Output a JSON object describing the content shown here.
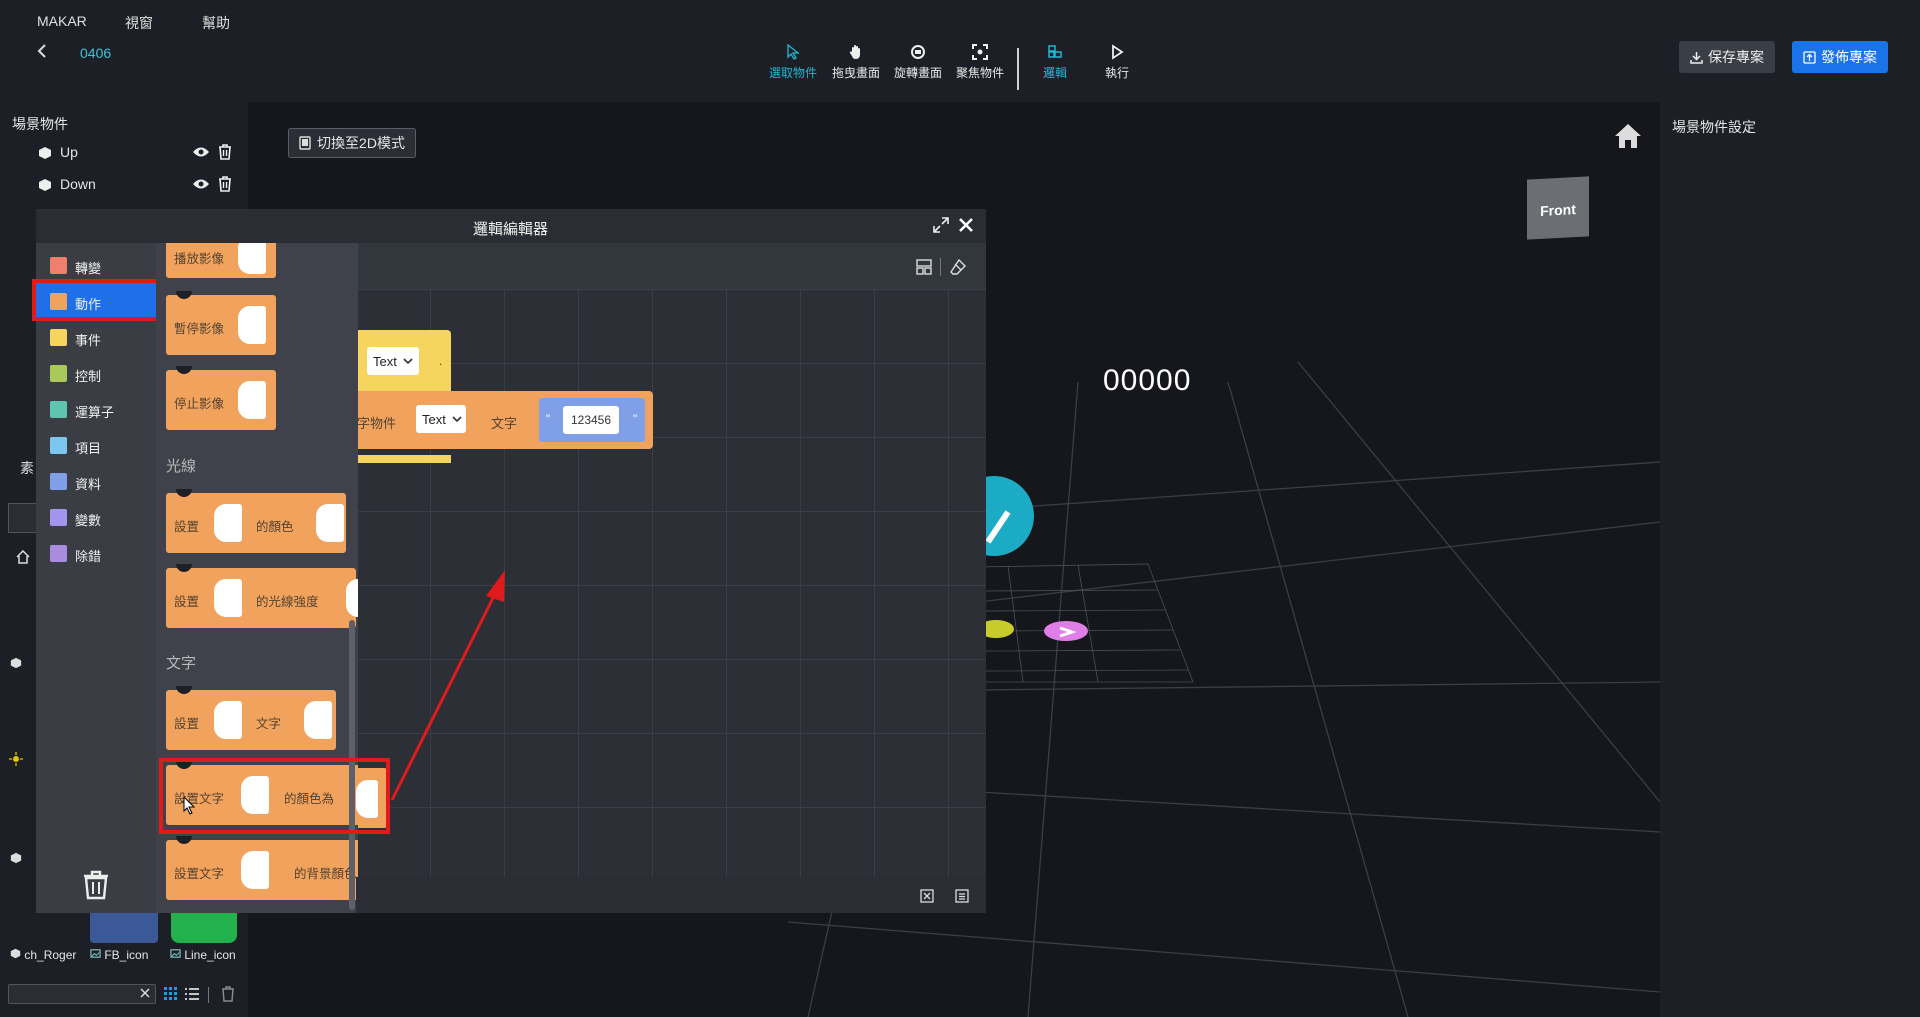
{
  "menu": [
    "MAKAR",
    "視窗",
    "幫助"
  ],
  "project_name": "0406",
  "tools": [
    {
      "label": "選取物件",
      "active": true
    },
    {
      "label": "拖曳畫面",
      "active": false
    },
    {
      "label": "旋轉畫面",
      "active": false
    },
    {
      "label": "聚焦物件",
      "active": false
    },
    {
      "label": "邏輯",
      "active": true
    },
    {
      "label": "執行",
      "active": false
    }
  ],
  "buttons": {
    "save": "保存專案",
    "publish": "發佈專案",
    "mode2d": "切換至2D模式"
  },
  "scene": {
    "title": "場景物件",
    "items": [
      {
        "name": "Up"
      },
      {
        "name": "Down"
      }
    ]
  },
  "right_panel": {
    "title": "場景物件設定"
  },
  "viewport": {
    "score": "00000",
    "cube_label": "Front"
  },
  "editor": {
    "title": "邏輯編輯器",
    "categories": [
      {
        "label": "轉變",
        "color": "#f07f6c"
      },
      {
        "label": "動作",
        "color": "#f1a35e",
        "selected": true
      },
      {
        "label": "事件",
        "color": "#f6d55f"
      },
      {
        "label": "控制",
        "color": "#a9c95b"
      },
      {
        "label": "運算子",
        "color": "#5fc5b0"
      },
      {
        "label": "項目",
        "color": "#7cc7ee"
      },
      {
        "label": "資料",
        "color": "#7fa0e8"
      },
      {
        "label": "變數",
        "color": "#a394f0"
      },
      {
        "label": "除錯",
        "color": "#a98be0"
      }
    ],
    "flyout": {
      "blocks_top": [
        {
          "label": "播放影像"
        },
        {
          "label": "暫停影像"
        },
        {
          "label": "停止影像"
        }
      ],
      "section_light": "光線",
      "light_blocks": [
        {
          "prefix": "設置",
          "suffix": "的顏色"
        },
        {
          "prefix": "設置",
          "suffix": "的光線強度"
        }
      ],
      "section_text": "文字",
      "text_blocks": [
        {
          "prefix": "設置",
          "suffix": "文字"
        },
        {
          "prefix": "設置文字",
          "suffix": "的顏色為"
        },
        {
          "prefix": "設置文字",
          "suffix": "的背景顏色"
        }
      ]
    },
    "workspace": {
      "select_top": "Text",
      "block_label": "字物件",
      "select_mid": "Text",
      "text_label": "文字",
      "quote_open": "\"",
      "quote_close": "\"",
      "value": "123456",
      "dot": "."
    }
  },
  "assets": [
    {
      "name": "ch_Roger"
    },
    {
      "name": "FB_icon"
    },
    {
      "name": "Line_icon"
    }
  ],
  "partial_label": "素"
}
